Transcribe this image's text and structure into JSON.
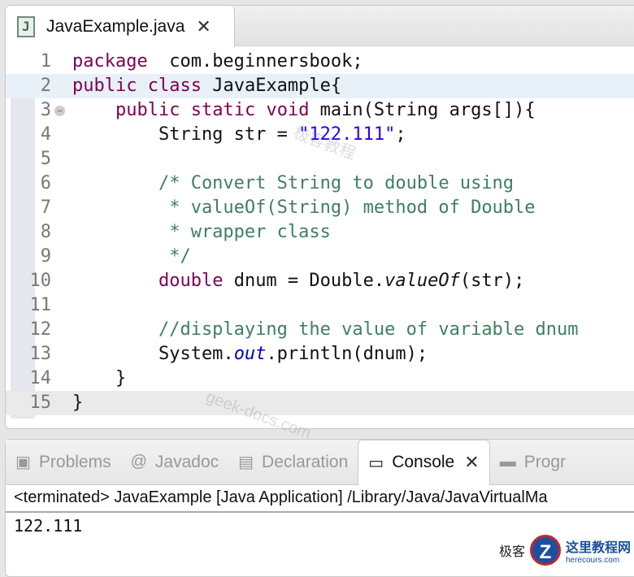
{
  "editor": {
    "tab_label": "JavaExample.java",
    "file_icon": "J",
    "lines": [
      {
        "n": "1",
        "parts": [
          [
            "kw",
            "package"
          ],
          [
            "",
            "  com.beginnersbook;"
          ]
        ]
      },
      {
        "n": "2",
        "parts": [
          [
            "kw",
            "public"
          ],
          [
            "",
            " "
          ],
          [
            "kw",
            "class"
          ],
          [
            "",
            " JavaExample{"
          ]
        ]
      },
      {
        "n": "3",
        "parts": [
          [
            "",
            "    "
          ],
          [
            "kw",
            "public"
          ],
          [
            "",
            " "
          ],
          [
            "kw",
            "static"
          ],
          [
            "",
            " "
          ],
          [
            "kw",
            "void"
          ],
          [
            "",
            " main(String args[]){"
          ]
        ]
      },
      {
        "n": "4",
        "parts": [
          [
            "",
            "        String str = "
          ],
          [
            "st",
            "\"122.111\""
          ],
          [
            "",
            ";"
          ]
        ]
      },
      {
        "n": "5",
        "parts": []
      },
      {
        "n": "6",
        "parts": [
          [
            "cm",
            "        /* Convert String to double using"
          ]
        ]
      },
      {
        "n": "7",
        "parts": [
          [
            "cm",
            "         * valueOf(String) method of Double"
          ]
        ]
      },
      {
        "n": "8",
        "parts": [
          [
            "cm",
            "         * wrapper class"
          ]
        ]
      },
      {
        "n": "9",
        "parts": [
          [
            "cm",
            "         */"
          ]
        ]
      },
      {
        "n": "10",
        "parts": [
          [
            "",
            "        "
          ],
          [
            "kw",
            "double"
          ],
          [
            "",
            " dnum = Double."
          ],
          [
            "it",
            "valueOf"
          ],
          [
            "",
            "(str);"
          ]
        ]
      },
      {
        "n": "11",
        "parts": []
      },
      {
        "n": "12",
        "parts": [
          [
            "cm",
            "        //displaying the value of variable dnum"
          ]
        ]
      },
      {
        "n": "13",
        "parts": [
          [
            "",
            "        System."
          ],
          [
            "fi",
            "out"
          ],
          [
            "",
            ".println(dnum);"
          ]
        ]
      },
      {
        "n": "14",
        "parts": [
          [
            "",
            "    }"
          ]
        ]
      },
      {
        "n": "15",
        "parts": [
          [
            "",
            "}"
          ]
        ]
      }
    ]
  },
  "panel": {
    "tabs": [
      {
        "icon": "▣",
        "label": "Problems"
      },
      {
        "icon": "@",
        "label": "Javadoc"
      },
      {
        "icon": "▤",
        "label": "Declaration"
      },
      {
        "icon": "▭",
        "label": "Console",
        "active": true
      },
      {
        "icon": "▬",
        "label": "Progr"
      }
    ],
    "status": "<terminated> JavaExample [Java Application] /Library/Java/JavaVirtualMa",
    "output": "122.111"
  },
  "watermarks": {
    "wm1": "极客教程",
    "wm2": "geek-docs.com",
    "logo_title": "这里教程网",
    "logo_url": "herecours.com",
    "logo_prefix": "极客"
  }
}
